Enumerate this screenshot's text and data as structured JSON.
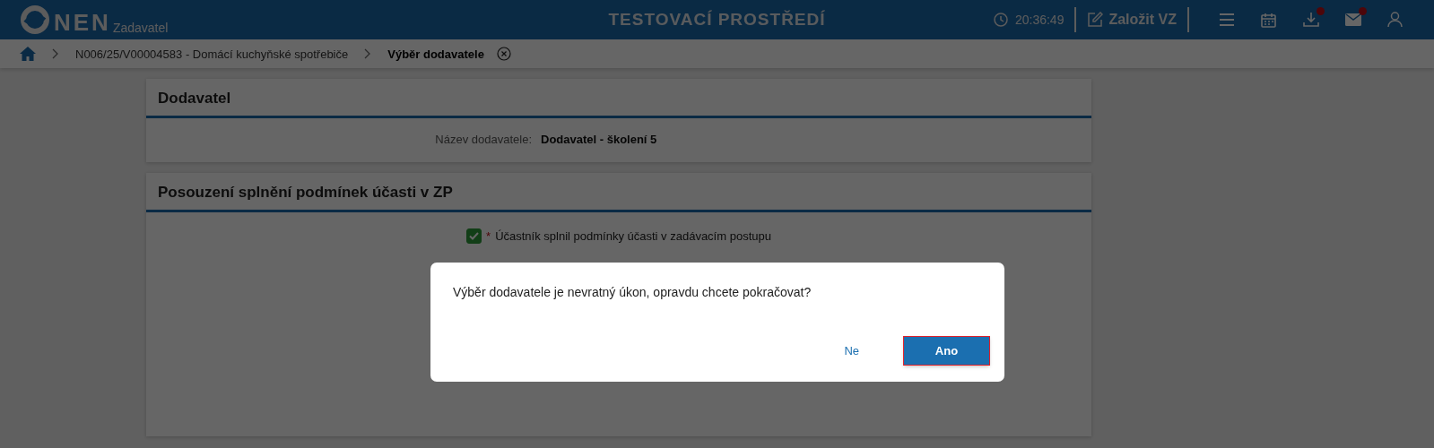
{
  "header": {
    "logo": "NEN",
    "subtitle": "Zadavatel",
    "title": "TESTOVACÍ PROSTŘEDÍ",
    "time": "20:36:49",
    "create_button": "Založit VZ",
    "toolbar": [
      {
        "kind": "menu",
        "badge": false
      },
      {
        "kind": "calendar",
        "badge": false
      },
      {
        "kind": "download",
        "badge": true
      },
      {
        "kind": "mail",
        "badge": true
      },
      {
        "kind": "user",
        "badge": false
      }
    ]
  },
  "breadcrumb": [
    {
      "label": "N006/25/V00004583 - Domácí kuchyňské spotřebiče",
      "current": false
    },
    {
      "label": "Výběr dodavatele",
      "current": true
    }
  ],
  "sections": [
    {
      "title": "Dodavatel",
      "fields": [
        {
          "label": "Název dodavatele:",
          "value": "Dodavatel - školení 5"
        }
      ]
    },
    {
      "title": "Posouzení splnění podmínek účasti v ZP",
      "checkbox": {
        "required_mark": "*",
        "label": "Účastník splnil podmínky účasti v zadávacím postupu",
        "checked": true
      }
    }
  ],
  "dialog": {
    "message": "Výběr dodavatele je nevratný úkon, opravdu chcete pokračovat?",
    "buttons": [
      {
        "label": "Ne",
        "kind": "text",
        "focused": false
      },
      {
        "label": "Ano",
        "kind": "primary",
        "focused": true
      }
    ]
  }
}
